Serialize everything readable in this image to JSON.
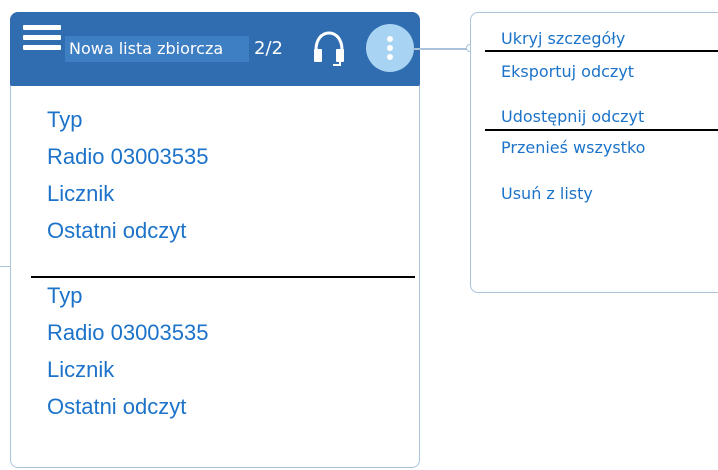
{
  "header": {
    "title": "Nowa lista zbiorcza",
    "page_counter": "2/2",
    "menu_icon": "hamburger-menu-icon",
    "support_icon": "headset-icon",
    "more_icon": "vertical-dots-icon"
  },
  "records": [
    {
      "type_label": "Typ",
      "radio": "Radio 03003535",
      "meter_label": "Licznik",
      "last_reading_label": "Ostatni odczyt"
    },
    {
      "type_label": "Typ",
      "radio": "Radio 03003535",
      "meter_label": "Licznik",
      "last_reading_label": "Ostatni odczyt"
    }
  ],
  "context_menu": {
    "items": [
      "Ukryj szczegóły",
      "Eksportuj odczyt",
      "Udostępnij odczyt",
      "Przenieś wszystko",
      "Usuń z listy"
    ]
  },
  "colors": {
    "header_bg": "#2f6db0",
    "accent_text": "#1c73c9",
    "kebab_bg": "#a9d3f2",
    "border": "#a9c3da"
  }
}
